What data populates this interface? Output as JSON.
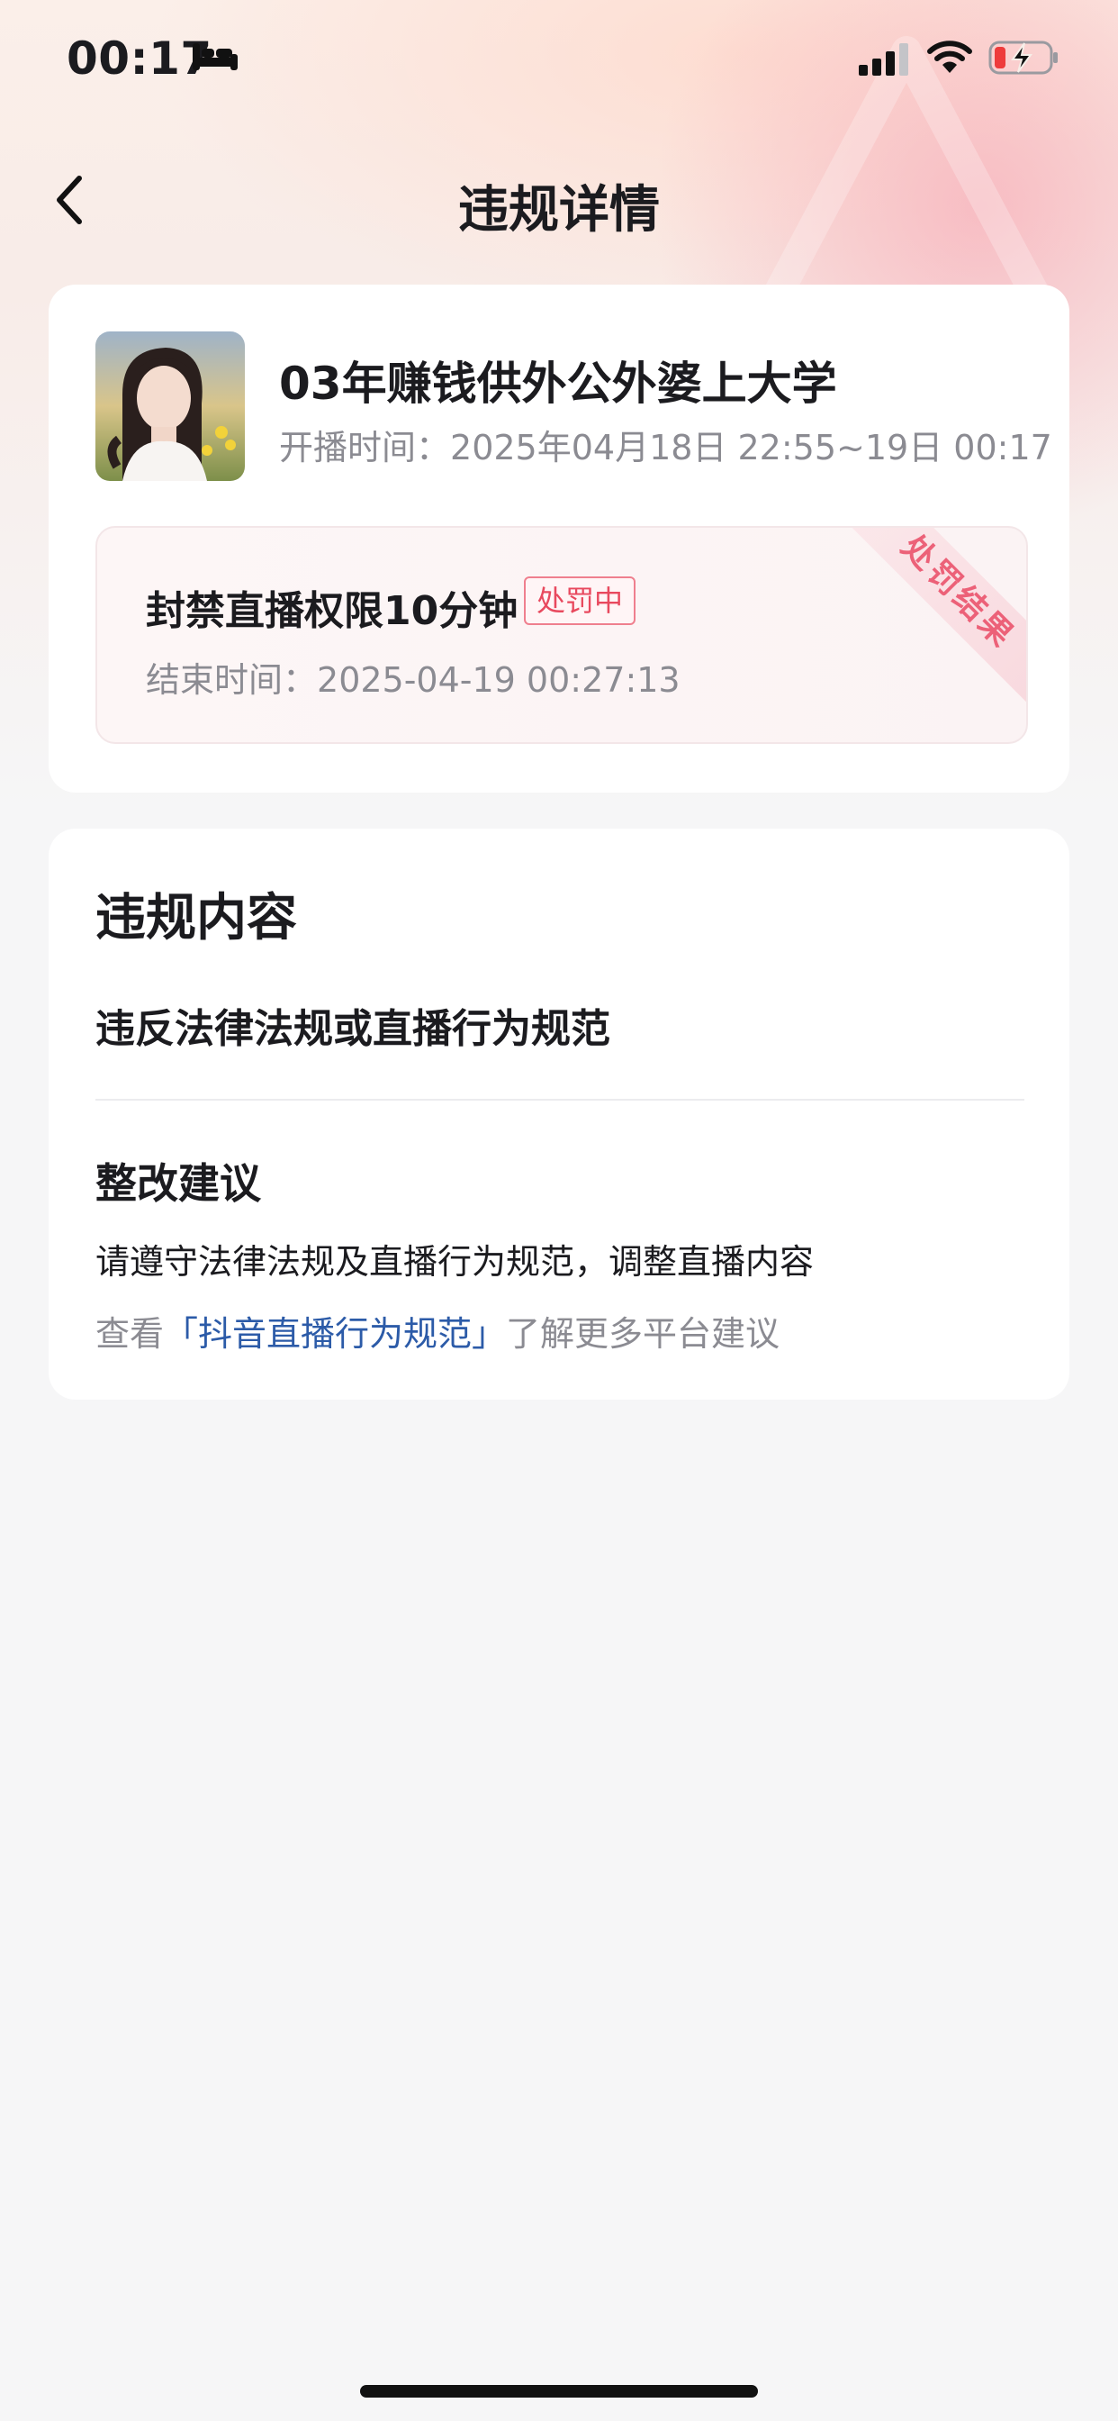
{
  "status_bar": {
    "time": "00:17"
  },
  "nav": {
    "title": "违规详情"
  },
  "live": {
    "title": "03年赚钱供外公外婆上大学",
    "time_label": "开播时间：",
    "time_value": "2025年04月18日 22:55~19日 00:17"
  },
  "penalty": {
    "title": "封禁直播权限10分钟",
    "status": "处罚中",
    "end_label": "结束时间：",
    "end_value": "2025-04-19 00:27:13",
    "ribbon": "处罚结果"
  },
  "violation": {
    "section_title": "违规内容",
    "text": "违反法律法规或直播行为规范",
    "advice_title": "整改建议",
    "advice_text": "请遵守法律法规及直播行为规范，调整直播内容",
    "advice_prefix": "查看",
    "advice_link": "「抖音直播行为规范」",
    "advice_suffix": "了解更多平台建议"
  },
  "colors": {
    "accent_red": "#e8495e",
    "link_blue": "#2c5ba8"
  }
}
